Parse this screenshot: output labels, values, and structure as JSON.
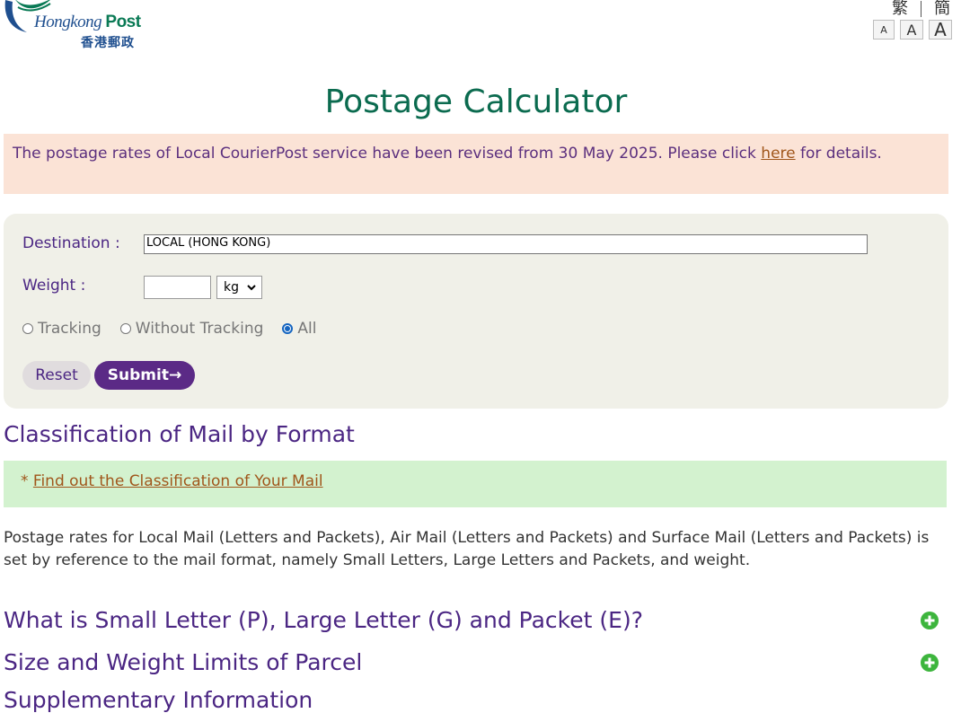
{
  "header": {
    "logo_en_italic": "Hongkong",
    "logo_en_bold": "Post",
    "logo_zh": "香港郵政",
    "lang_trad": "繁",
    "lang_simp": "簡",
    "font_small": "A",
    "font_medium": "A",
    "font_large": "A"
  },
  "page": {
    "title": "Postage Calculator"
  },
  "notice": {
    "text_before": "The postage rates of Local CourierPost service have been revised from 30 May 2025. Please click ",
    "link": "here",
    "text_after": " for details."
  },
  "form": {
    "destination_label": "Destination :",
    "destination_value": "LOCAL (HONG KONG)",
    "weight_label": "Weight :",
    "weight_value": "",
    "unit_selected": "kg",
    "radios": [
      "Tracking",
      "Without Tracking",
      "All"
    ],
    "radio_selected": "All",
    "reset_label": "Reset",
    "submit_label": "Submit→"
  },
  "classification": {
    "heading": "Classification of Mail by Format",
    "star": "* ",
    "link": "Find out the Classification of Your Mail",
    "paragraph": "Postage rates for Local Mail (Letters and Packets), Air Mail (Letters and Packets) and Surface Mail (Letters and Packets) is set by reference to the mail format, namely Small Letters, Large Letters and Packets, and weight."
  },
  "sections": [
    "What is Small Letter (P), Large Letter (G) and Packet (E)?",
    "Size and Weight Limits of Parcel",
    "Supplementary Information"
  ],
  "colors": {
    "title_green": "#0b6b4f",
    "heading_purple": "#4b2683",
    "submit_purple": "#5b2a86",
    "notice_bg": "#fbe3d6",
    "green_box_bg": "#d3f2cf",
    "form_bg": "#f0f0e8",
    "plus_icon": "#3db53d"
  }
}
